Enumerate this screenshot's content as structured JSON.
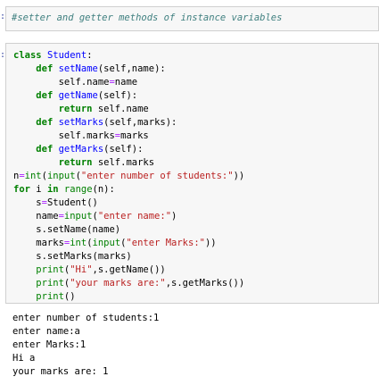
{
  "markdown_cell": {
    "marker": ":",
    "text": "#setter and getter methods of instance variables"
  },
  "code_cell": {
    "marker": ":",
    "lines": [
      [
        {
          "t": "class",
          "c": "kw"
        },
        {
          "t": " "
        },
        {
          "t": "Student",
          "c": "nm"
        },
        {
          "t": ":"
        }
      ],
      [
        {
          "t": "    "
        },
        {
          "t": "def",
          "c": "kw"
        },
        {
          "t": " "
        },
        {
          "t": "setName",
          "c": "nm"
        },
        {
          "t": "(self,name):"
        }
      ],
      [
        {
          "t": "        self.name"
        },
        {
          "t": "=",
          "c": "op"
        },
        {
          "t": "name"
        }
      ],
      [
        {
          "t": "    "
        },
        {
          "t": "def",
          "c": "kw"
        },
        {
          "t": " "
        },
        {
          "t": "getName",
          "c": "nm"
        },
        {
          "t": "(self):"
        }
      ],
      [
        {
          "t": "        "
        },
        {
          "t": "return",
          "c": "kw"
        },
        {
          "t": " self.name"
        }
      ],
      [
        {
          "t": "    "
        },
        {
          "t": "def",
          "c": "kw"
        },
        {
          "t": " "
        },
        {
          "t": "setMarks",
          "c": "nm"
        },
        {
          "t": "(self,marks):"
        }
      ],
      [
        {
          "t": "        self.marks"
        },
        {
          "t": "=",
          "c": "op"
        },
        {
          "t": "marks"
        }
      ],
      [
        {
          "t": "    "
        },
        {
          "t": "def",
          "c": "kw"
        },
        {
          "t": " "
        },
        {
          "t": "getMarks",
          "c": "nm"
        },
        {
          "t": "(self):"
        }
      ],
      [
        {
          "t": "        "
        },
        {
          "t": "return",
          "c": "kw"
        },
        {
          "t": " self.marks"
        }
      ],
      [
        {
          "t": "n"
        },
        {
          "t": "=",
          "c": "op"
        },
        {
          "t": "int",
          "c": "bi"
        },
        {
          "t": "("
        },
        {
          "t": "input",
          "c": "bi"
        },
        {
          "t": "("
        },
        {
          "t": "\"enter number of students:\"",
          "c": "st"
        },
        {
          "t": "))"
        }
      ],
      [
        {
          "t": "for",
          "c": "kw"
        },
        {
          "t": " i "
        },
        {
          "t": "in",
          "c": "kw"
        },
        {
          "t": " "
        },
        {
          "t": "range",
          "c": "bi"
        },
        {
          "t": "(n):"
        }
      ],
      [
        {
          "t": "    s"
        },
        {
          "t": "=",
          "c": "op"
        },
        {
          "t": "Student()"
        }
      ],
      [
        {
          "t": "    name"
        },
        {
          "t": "=",
          "c": "op"
        },
        {
          "t": "input",
          "c": "bi"
        },
        {
          "t": "("
        },
        {
          "t": "\"enter name:\"",
          "c": "st"
        },
        {
          "t": ")"
        }
      ],
      [
        {
          "t": "    s.setName(name)"
        }
      ],
      [
        {
          "t": "    marks"
        },
        {
          "t": "=",
          "c": "op"
        },
        {
          "t": "int",
          "c": "bi"
        },
        {
          "t": "("
        },
        {
          "t": "input",
          "c": "bi"
        },
        {
          "t": "("
        },
        {
          "t": "\"enter Marks:\"",
          "c": "st"
        },
        {
          "t": "))"
        }
      ],
      [
        {
          "t": "    s.setMarks(marks)"
        }
      ],
      [
        {
          "t": "    "
        },
        {
          "t": "print",
          "c": "bi"
        },
        {
          "t": "("
        },
        {
          "t": "\"Hi\"",
          "c": "st"
        },
        {
          "t": ",s.getName())"
        }
      ],
      [
        {
          "t": "    "
        },
        {
          "t": "print",
          "c": "bi"
        },
        {
          "t": "("
        },
        {
          "t": "\"your marks are:\"",
          "c": "st"
        },
        {
          "t": ",s.getMarks())"
        }
      ],
      [
        {
          "t": "    "
        },
        {
          "t": "print",
          "c": "bi"
        },
        {
          "t": "()"
        }
      ]
    ]
  },
  "output": {
    "lines": [
      "enter number of students:1",
      "enter name:a",
      "enter Marks:1",
      "Hi a",
      "your marks are: 1"
    ]
  },
  "colors": {
    "keyword": "#008000",
    "definition_name": "#0000ff",
    "string": "#ba2121",
    "operator": "#aa22ff",
    "comment": "#408080"
  }
}
